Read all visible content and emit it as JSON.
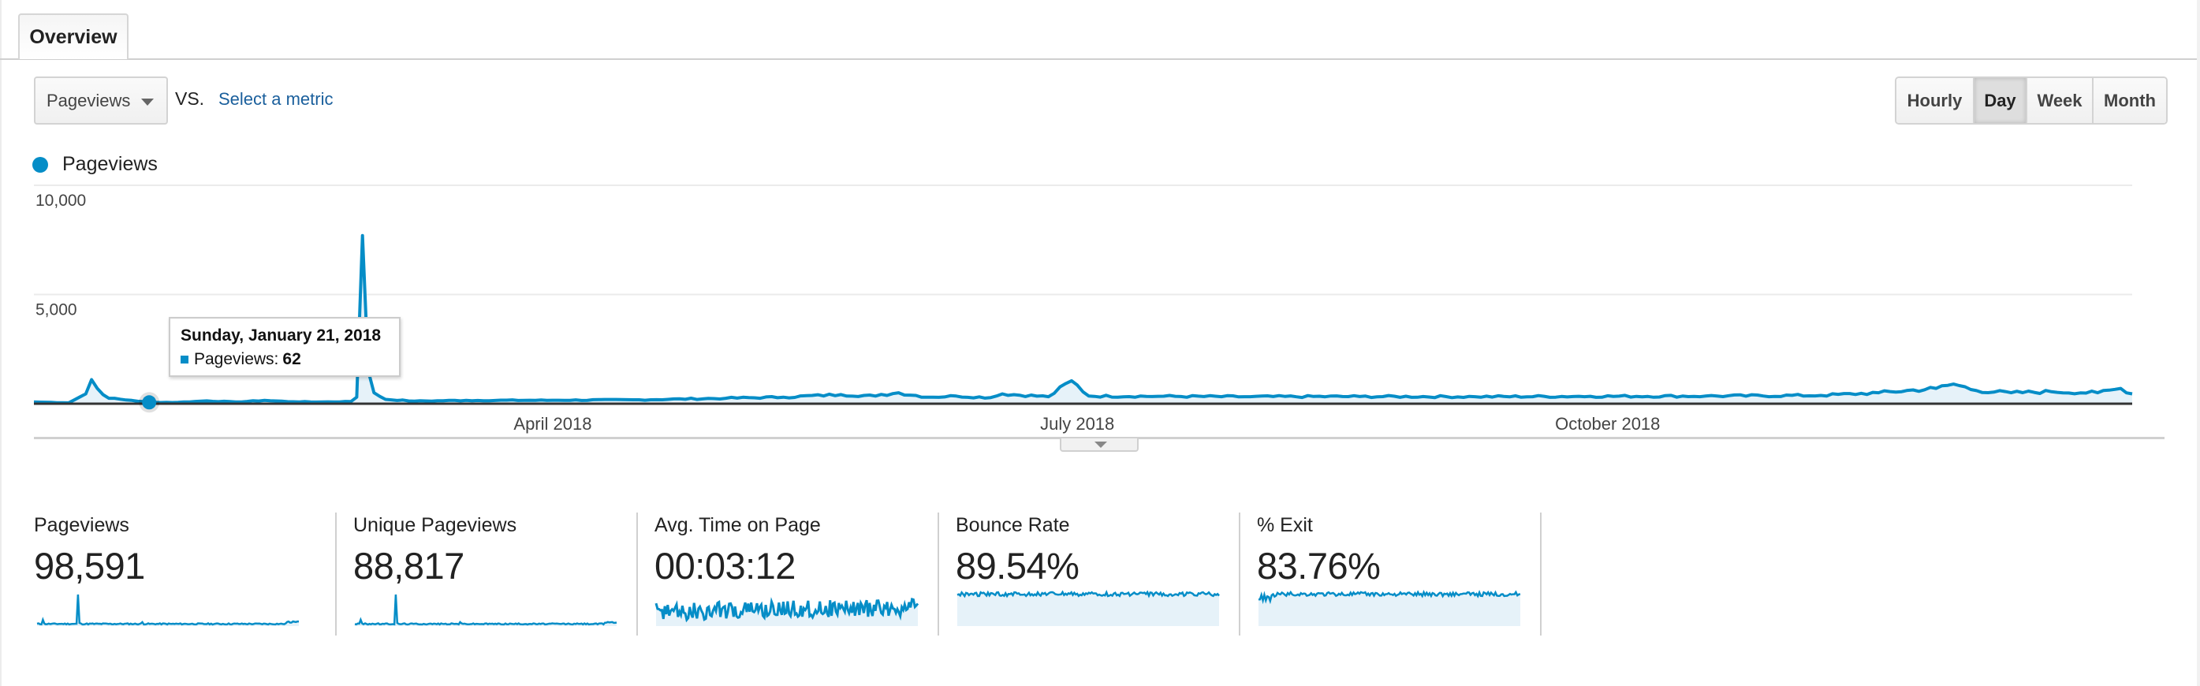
{
  "tabs": [
    {
      "label": "Overview",
      "active": true
    }
  ],
  "controls": {
    "metric_dropdown": {
      "selected": "Pageviews"
    },
    "vs_label": "VS.",
    "compare_link": "Select a metric",
    "granularity": [
      {
        "label": "Hourly",
        "active": false
      },
      {
        "label": "Day",
        "active": true
      },
      {
        "label": "Week",
        "active": false
      },
      {
        "label": "Month",
        "active": false
      }
    ]
  },
  "colors": {
    "series": "#058dc7",
    "area": "#e6f2f9",
    "link": "#1a5f9c"
  },
  "tooltip": {
    "date": "Sunday, January 21, 2018",
    "metric": "Pageviews:",
    "value": "62"
  },
  "chart_data": {
    "type": "area",
    "title": "",
    "legend": [
      {
        "name": "Pageviews",
        "position": "top-left"
      }
    ],
    "xlabel": "",
    "ylabel": "",
    "ylim": [
      0,
      10000
    ],
    "yticks": [
      {
        "value": 10000,
        "label": "10,000"
      },
      {
        "value": 5000,
        "label": "5,000"
      }
    ],
    "x_range": [
      "2018-01-01",
      "2018-12-31"
    ],
    "xticks": [
      {
        "date": "2018-04-01",
        "label": "April 2018"
      },
      {
        "date": "2018-07-01",
        "label": "July 2018"
      },
      {
        "date": "2018-10-01",
        "label": "October 2018"
      }
    ],
    "grid": true,
    "highlight": {
      "date": "2018-01-21",
      "value": 62
    },
    "series": [
      {
        "name": "Pageviews",
        "keypoints": [
          {
            "day": 0,
            "value": 80
          },
          {
            "day": 3,
            "value": 60
          },
          {
            "day": 6,
            "value": 40
          },
          {
            "day": 9,
            "value": 450
          },
          {
            "day": 10,
            "value": 1100
          },
          {
            "day": 11,
            "value": 700
          },
          {
            "day": 13,
            "value": 250
          },
          {
            "day": 17,
            "value": 150
          },
          {
            "day": 20,
            "value": 62
          },
          {
            "day": 25,
            "value": 60
          },
          {
            "day": 30,
            "value": 130
          },
          {
            "day": 35,
            "value": 80
          },
          {
            "day": 40,
            "value": 150
          },
          {
            "day": 45,
            "value": 90
          },
          {
            "day": 50,
            "value": 80
          },
          {
            "day": 55,
            "value": 100
          },
          {
            "day": 56,
            "value": 300
          },
          {
            "day": 57,
            "value": 7700
          },
          {
            "day": 58,
            "value": 1500
          },
          {
            "day": 59,
            "value": 500
          },
          {
            "day": 61,
            "value": 200
          },
          {
            "day": 66,
            "value": 120
          },
          {
            "day": 75,
            "value": 150
          },
          {
            "day": 90,
            "value": 160
          },
          {
            "day": 105,
            "value": 180
          },
          {
            "day": 120,
            "value": 250
          },
          {
            "day": 130,
            "value": 300
          },
          {
            "day": 140,
            "value": 420
          },
          {
            "day": 146,
            "value": 350
          },
          {
            "day": 150,
            "value": 500
          },
          {
            "day": 155,
            "value": 300
          },
          {
            "day": 160,
            "value": 350
          },
          {
            "day": 166,
            "value": 280
          },
          {
            "day": 168,
            "value": 450
          },
          {
            "day": 176,
            "value": 320
          },
          {
            "day": 180,
            "value": 1050
          },
          {
            "day": 183,
            "value": 350
          },
          {
            "day": 195,
            "value": 340
          },
          {
            "day": 210,
            "value": 320
          },
          {
            "day": 230,
            "value": 330
          },
          {
            "day": 250,
            "value": 320
          },
          {
            "day": 270,
            "value": 340
          },
          {
            "day": 290,
            "value": 350
          },
          {
            "day": 310,
            "value": 380
          },
          {
            "day": 320,
            "value": 500
          },
          {
            "day": 330,
            "value": 700
          },
          {
            "day": 333,
            "value": 900
          },
          {
            "day": 337,
            "value": 600
          },
          {
            "day": 343,
            "value": 500
          },
          {
            "day": 350,
            "value": 550
          },
          {
            "day": 358,
            "value": 500
          },
          {
            "day": 362,
            "value": 700
          },
          {
            "day": 364,
            "value": 450
          }
        ]
      }
    ]
  },
  "scorecards": [
    {
      "label": "Pageviews",
      "value": "98,591",
      "spark": "spike"
    },
    {
      "label": "Unique Pageviews",
      "value": "88,817",
      "spark": "spike"
    },
    {
      "label": "Avg. Time on Page",
      "value": "00:03:12",
      "spark": "noisy"
    },
    {
      "label": "Bounce Rate",
      "value": "89.54%",
      "spark": "high-flat"
    },
    {
      "label": "% Exit",
      "value": "83.76%",
      "spark": "high-flat"
    }
  ]
}
